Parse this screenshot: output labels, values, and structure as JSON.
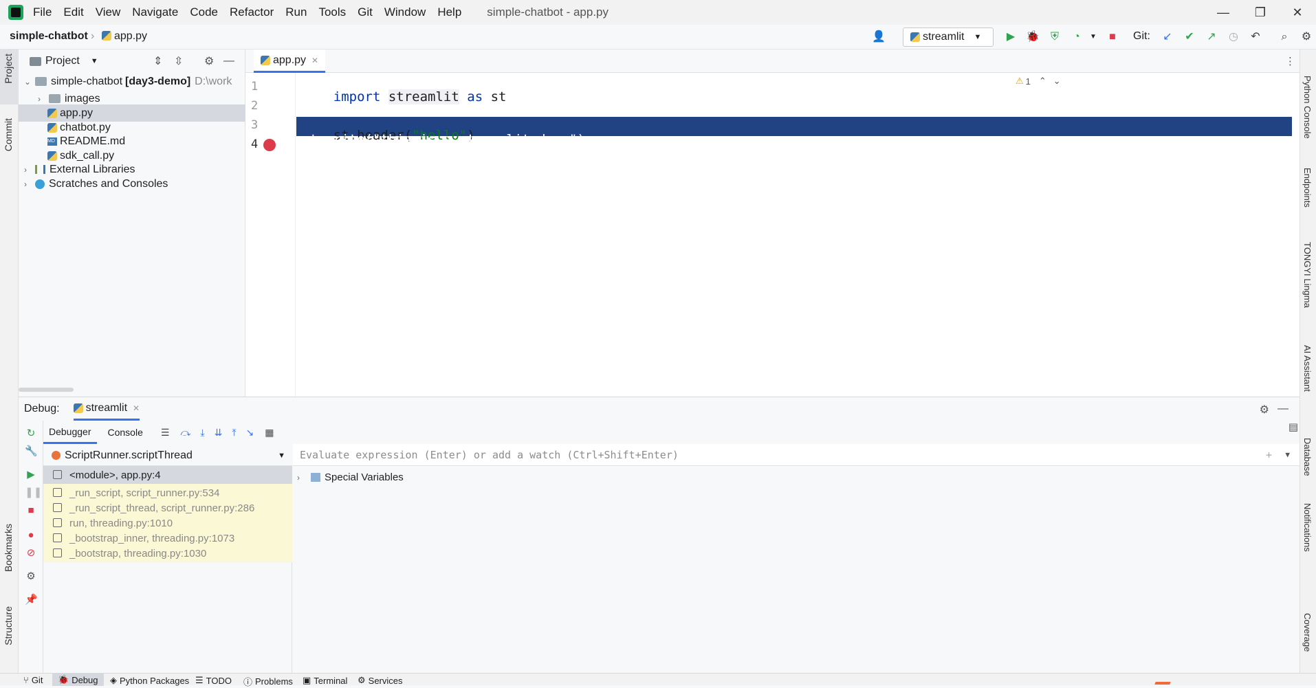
{
  "titlebar": {
    "menu": [
      "File",
      "Edit",
      "View",
      "Navigate",
      "Code",
      "Refactor",
      "Run",
      "Tools",
      "Git",
      "Window",
      "Help"
    ],
    "title": "simple-chatbot - app.py",
    "minimize": "—",
    "restore": "❐",
    "close": "✕"
  },
  "navbar": {
    "project": "simple-chatbot",
    "file": "app.py",
    "run_config": "streamlit",
    "git_label": "Git:"
  },
  "left_strip": {
    "project": "Project",
    "commit": "Commit",
    "bookmarks": "Bookmarks",
    "structure": "Structure"
  },
  "right_strip": [
    "Python Console",
    "Endpoints",
    "TONGYI Lingma",
    "AI Assistant",
    "Database",
    "Notifications",
    "Coverage"
  ],
  "project_panel": {
    "title": "Project",
    "root": "simple-chatbot",
    "root_bold": "[day3-demo]",
    "root_path": "D:\\work",
    "items": [
      "images",
      "app.py",
      "chatbot.py",
      "README.md",
      "sdk_call.py"
    ],
    "external": "External Libraries",
    "scratches": "Scratches and Consoles"
  },
  "editor": {
    "tab": "app.py",
    "line_numbers": [
      "1",
      "2",
      "3",
      "4"
    ],
    "lines": {
      "l1_import": "import",
      "l1_mod": "streamlit",
      "l1_as": "as",
      "l1_alias": "st",
      "l3_call": "st.header(",
      "l3_str": "\"hello\"",
      "l3_end": ")",
      "l4": "st.write(\"this is a streamlit demo\")"
    },
    "warning_count": "1"
  },
  "debug": {
    "label": "Debug:",
    "session": "streamlit",
    "tabs": [
      "Debugger",
      "Console"
    ],
    "thread": "ScriptRunner.scriptThread",
    "frames": [
      "<module>, app.py:4",
      "_run_script, script_runner.py:534",
      "_run_script_thread, script_runner.py:286",
      "run, threading.py:1010",
      "_bootstrap_inner, threading.py:1073",
      "_bootstrap, threading.py:1030"
    ],
    "eval_placeholder": "Evaluate expression (Enter) or add a watch (Ctrl+Shift+Enter)",
    "special_vars": "Special Variables"
  },
  "statusbar": [
    "Git",
    "Debug",
    "Python Packages",
    "TODO",
    "Problems",
    "Terminal",
    "Services"
  ],
  "colors": {
    "accent": "#3574f0",
    "selection": "#214283",
    "breakpoint": "#db3b4b",
    "frame_bg": "#fbf9d5"
  }
}
